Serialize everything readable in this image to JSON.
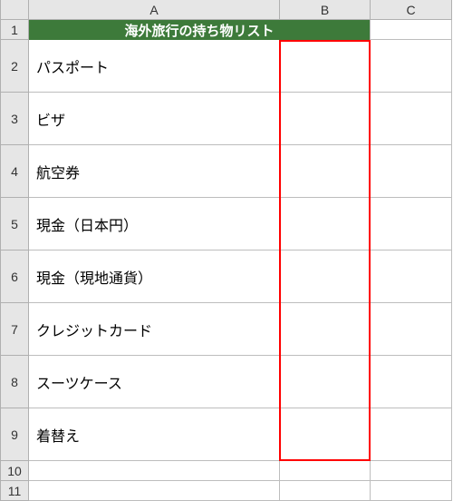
{
  "columns": [
    "A",
    "B",
    "C"
  ],
  "title": "海外旅行の持ち物リスト",
  "rows": [
    {
      "num": 1,
      "a": "",
      "b": ""
    },
    {
      "num": 2,
      "a": "パスポート",
      "b": ""
    },
    {
      "num": 3,
      "a": "ビザ",
      "b": ""
    },
    {
      "num": 4,
      "a": "航空券",
      "b": ""
    },
    {
      "num": 5,
      "a": "現金（日本円）",
      "b": ""
    },
    {
      "num": 6,
      "a": "現金（現地通貨）",
      "b": ""
    },
    {
      "num": 7,
      "a": "クレジットカード",
      "b": ""
    },
    {
      "num": 8,
      "a": "スーツケース",
      "b": ""
    },
    {
      "num": 9,
      "a": "着替え",
      "b": ""
    },
    {
      "num": 10,
      "a": "",
      "b": ""
    },
    {
      "num": 11,
      "a": "",
      "b": ""
    }
  ],
  "highlight": {
    "colStart": "B",
    "rowStart": 2,
    "colEnd": "B",
    "rowEnd": 9
  }
}
